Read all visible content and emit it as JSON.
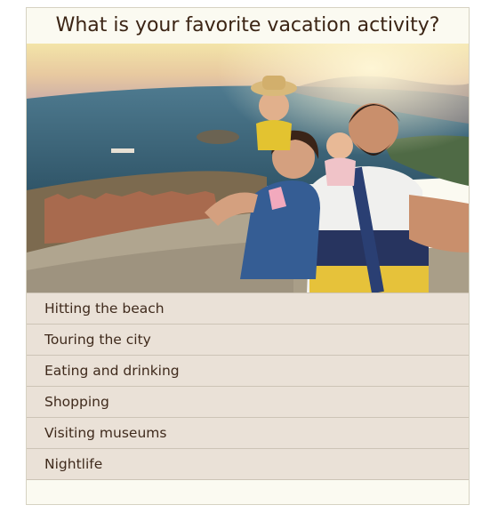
{
  "poll": {
    "question": "What is your favorite vacation activity?",
    "options": [
      "Hitting the beach",
      "Touring the city",
      "Eating and drinking",
      "Shopping",
      "Visiting museums",
      "Nightlife"
    ]
  },
  "colors": {
    "card_background": "#fbfaf1",
    "option_background": "#eae1d7",
    "text": "#3b2414"
  }
}
